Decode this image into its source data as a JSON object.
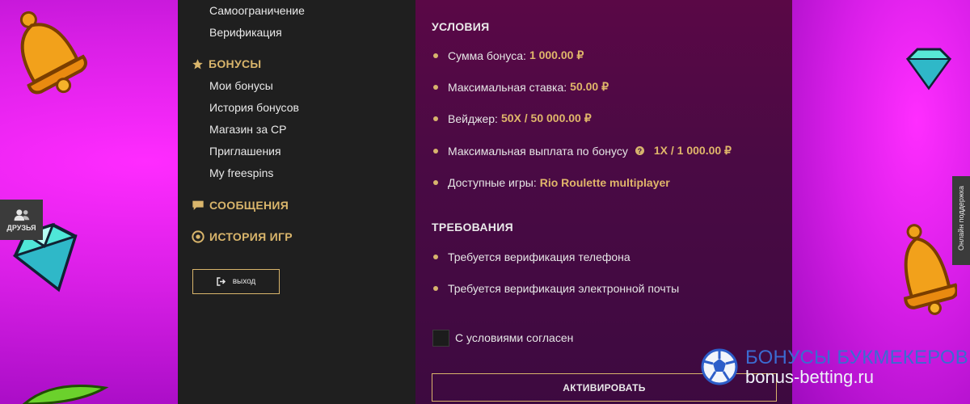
{
  "sidebar": {
    "account_items": [
      "Самоограничение",
      "Верификация"
    ],
    "bonuses": {
      "heading": "БОНУСЫ",
      "items": [
        "Мои бонусы",
        "История бонусов",
        "Магазин за СР",
        "Приглашения",
        "My freespins"
      ]
    },
    "messages_heading": "СООБЩЕНИЯ",
    "games_history_heading": "ИСТОРИЯ ИГР",
    "exit_label": "выход"
  },
  "conditions": {
    "heading": "УСЛОВИЯ",
    "items": [
      {
        "label": "Сумма бонуса:",
        "value": "1 000.00 ₽"
      },
      {
        "label": "Максимальная ставка:",
        "value": "50.00 ₽"
      },
      {
        "label": "Вейджер:",
        "value": "50X / 50 000.00 ₽"
      },
      {
        "label": "Максимальная выплата по бонусу",
        "value": "1X / 1 000.00 ₽"
      },
      {
        "label": "Доступные игры:",
        "value": "Rio Roulette multiplayer"
      }
    ]
  },
  "requirements": {
    "heading": "ТРЕБОВАНИЯ",
    "items": [
      "Требуется верификация телефона",
      "Требуется верификация электронной почты"
    ]
  },
  "agree_label": "С условиями согласен",
  "activate_label": "АКТИВИРОВАТЬ",
  "friends_tab_label": "ДРУЗЬЯ",
  "support_tab_label": "Онлайн поддержка",
  "watermark": {
    "line1": "БОНУСЫ БУКМЕКЕРОВ",
    "line2": "bonus-betting.ru"
  },
  "colors": {
    "accent_gold": "#d9b56b",
    "sidebar_bg": "#1f1f1f",
    "content_bg": "#4a0a44",
    "background_magenta": "#d91fe6"
  }
}
